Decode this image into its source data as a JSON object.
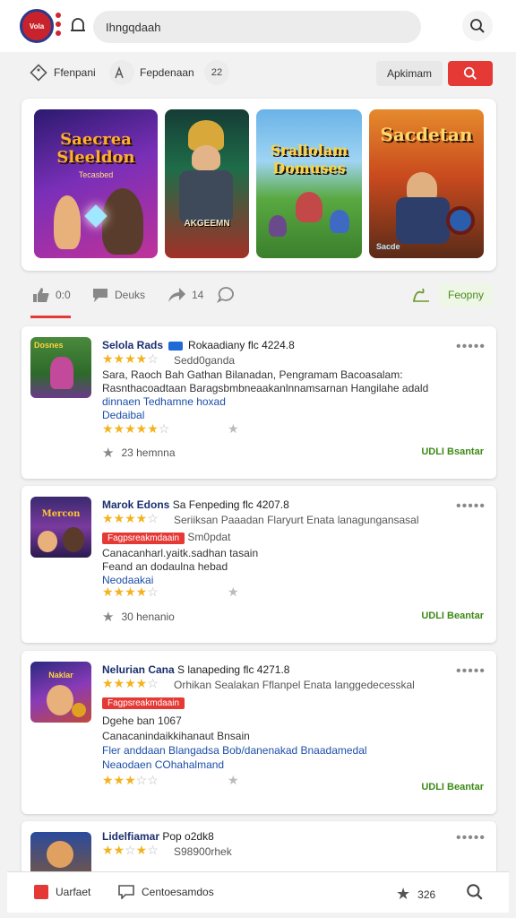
{
  "header": {
    "logo_text": "Vola",
    "search_text": "Ihngqdaah"
  },
  "filters": {
    "chip1": "Ffenpani",
    "chip2": "Fepdenaan",
    "chip3": "22",
    "grey_button": "Apkimam"
  },
  "featured": [
    {
      "title": "Saecrea\nSleeldon",
      "subtitle": "Tecasbed"
    },
    {
      "title": "",
      "subtitle": "AKGEEMN"
    },
    {
      "title": "Sraliolam\nDomuses",
      "subtitle": ""
    },
    {
      "title": "Sacdetan",
      "subtitle": "Sacde"
    }
  ],
  "stats": {
    "likes": "0:0",
    "comments": "Deuks",
    "shares": "14",
    "popular": "Feopny"
  },
  "cards": [
    {
      "thumb_label": "Dosnes",
      "title": "Selola Rads",
      "title_rest": "Rokaadiany  flc 4224.8",
      "sub": "Sedd0ganda",
      "desc1": "Sara, Raoch Bah Gathan Bilanadan, Pengramam Bacoasalam:",
      "desc2": "Rasnthacoadtaan Baragsbmbneaakanlnnamsarnan Hangilahe adald",
      "link1": "dinnaen  Tedhamne hoxad",
      "link2": "Dedaibal",
      "count": "23 hemnna",
      "action": "UDLI Bsantar",
      "stars": 4.5
    },
    {
      "thumb_label": "Mercon",
      "title": "Marok Edons",
      "title_rest": "Sa Fenpeding  flc 4207.8",
      "sub": "Seriiksan Paaadan Flaryurt Enata lanagungansasal",
      "tag": "Fagpsreakmdaain",
      "tag_rest": "Sm0pdat",
      "desc1": "Canacanharl.yaitk.sadhan tasain",
      "desc2": "Feand an dodaulna hebad",
      "link1": "Neodaakai",
      "count": "30 henanio",
      "action": "UDLI Beantar",
      "stars": 4
    },
    {
      "thumb_label": "Naklar",
      "title": "Nelurian Cana",
      "title_rest": "S lanapeding  flc 4271.8",
      "sub": "Orhikan Sealakan Fflanpel Enata langgedecesskal",
      "tag": "Fagpsreakmdaain",
      "tag_rest": "",
      "desc1": "Dgehe ban 1067",
      "desc2": "Canacanindaikkihanaut Bnsain",
      "link1": "Fler anddaan Blangadsa Bob/danenakad Bnaadamedal",
      "link2": "Neaodaen COhahalmand",
      "action": "UDLI Beantar",
      "stars": 3.5
    },
    {
      "title": "Lidelfiamar",
      "title_rest": "Pop  o2dk8",
      "sub": "S98900rhek",
      "stars": 3
    }
  ],
  "bottom": {
    "item1": "Uarfaet",
    "item2": "Centoesamdos",
    "count": "326"
  },
  "colors": {
    "accent_red": "#e53935",
    "link_blue": "#1b4fa8",
    "green": "#3d8a16",
    "star": "#f3b31f"
  }
}
